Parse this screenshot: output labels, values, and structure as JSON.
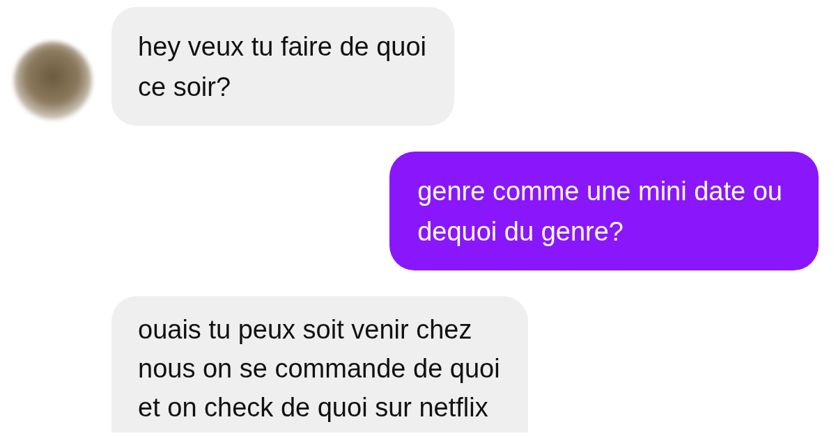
{
  "messages": [
    {
      "kind": "incoming",
      "avatar": true,
      "text": "hey veux tu faire de quoi\nce soir?"
    },
    {
      "kind": "outgoing",
      "avatar": false,
      "text": "genre comme une mini date ou\ndequoi du genre?"
    },
    {
      "kind": "incoming",
      "avatar": false,
      "text": "ouais tu peux soit venir chez\nnous on se commande de quoi\net on check de quoi sur netflix"
    }
  ]
}
